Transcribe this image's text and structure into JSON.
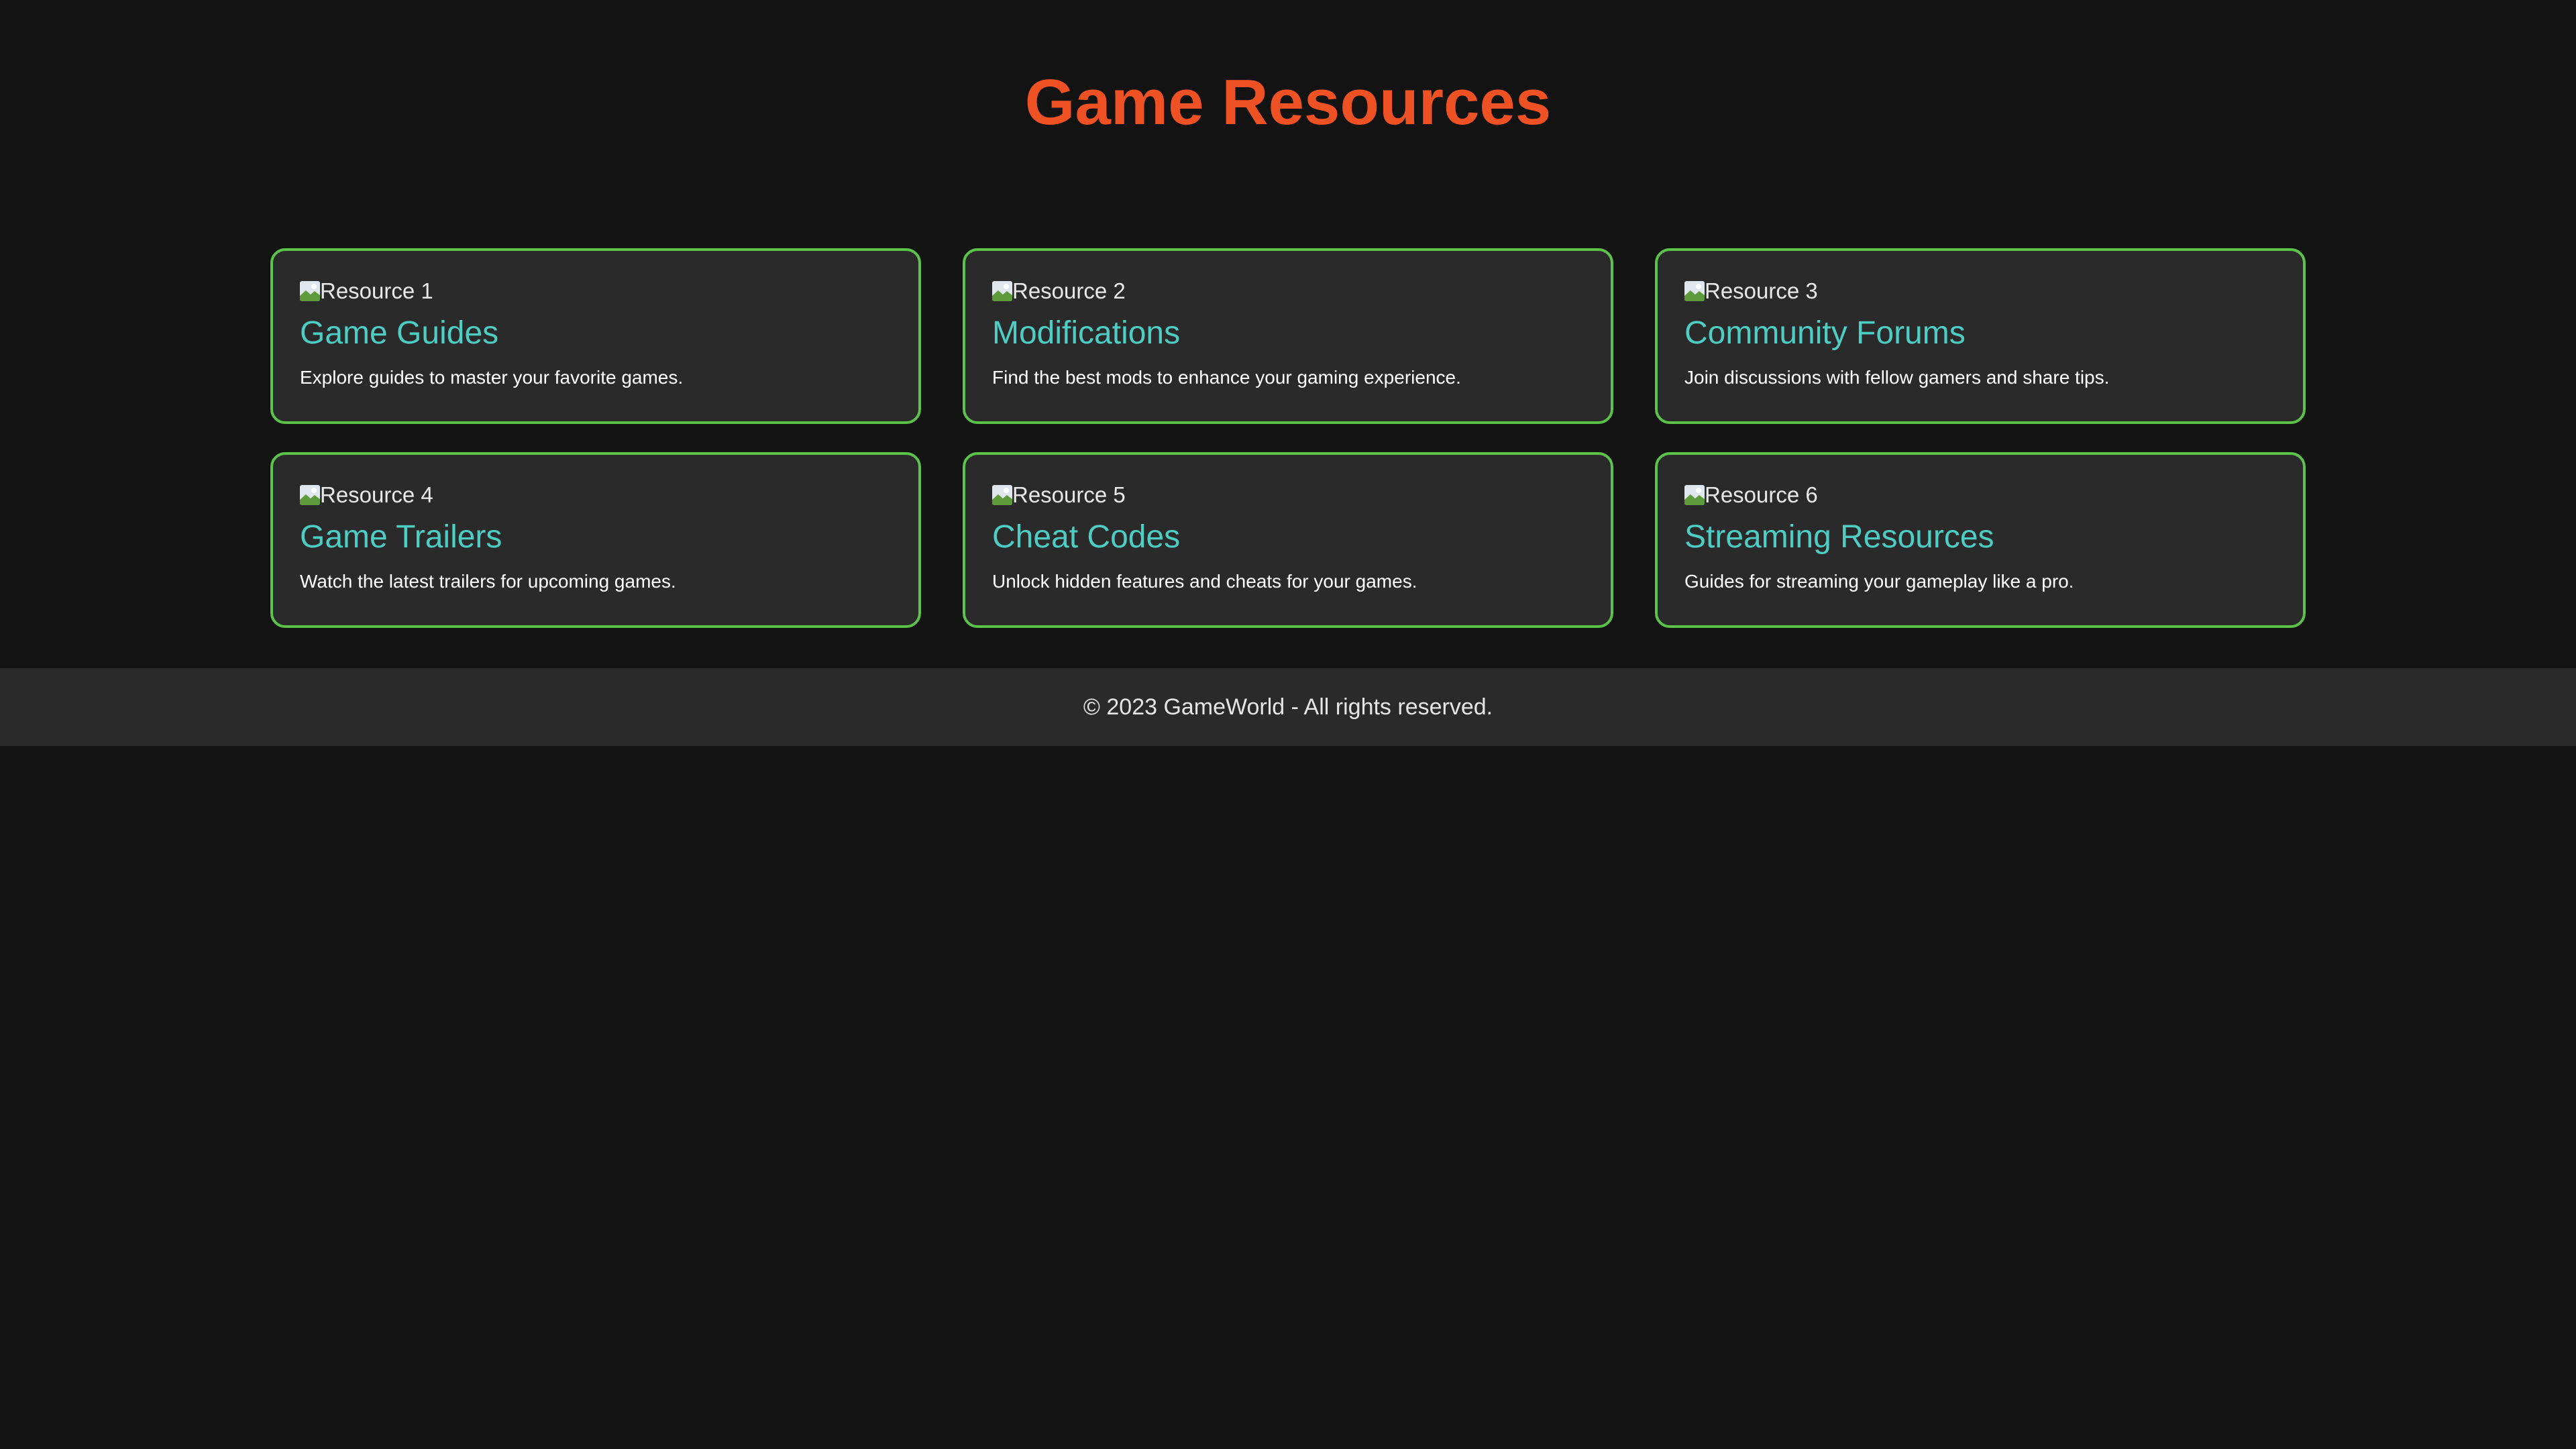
{
  "page": {
    "title": "Game Resources",
    "colors": {
      "background": "#131313",
      "title": "#ee5124",
      "card_background": "#2a2a2a",
      "card_border": "#5bc24a",
      "card_title": "#4ecdc4",
      "card_text": "#ffffff",
      "footer_background": "#2a2a2a"
    }
  },
  "resources": [
    {
      "image_alt": "Resource 1",
      "image_icon": "broken-image-icon",
      "title": "Game Guides",
      "description": "Explore guides to master your favorite games."
    },
    {
      "image_alt": "Resource 2",
      "image_icon": "broken-image-icon",
      "title": "Modifications",
      "description": "Find the best mods to enhance your gaming experience."
    },
    {
      "image_alt": "Resource 3",
      "image_icon": "broken-image-icon",
      "title": "Community Forums",
      "description": "Join discussions with fellow gamers and share tips."
    },
    {
      "image_alt": "Resource 4",
      "image_icon": "broken-image-icon",
      "title": "Game Trailers",
      "description": "Watch the latest trailers for upcoming games."
    },
    {
      "image_alt": "Resource 5",
      "image_icon": "broken-image-icon",
      "title": "Cheat Codes",
      "description": "Unlock hidden features and cheats for your games."
    },
    {
      "image_alt": "Resource 6",
      "image_icon": "broken-image-icon",
      "title": "Streaming Resources",
      "description": "Guides for streaming your gameplay like a pro."
    }
  ],
  "footer": {
    "text": "© 2023 GameWorld - All rights reserved."
  }
}
